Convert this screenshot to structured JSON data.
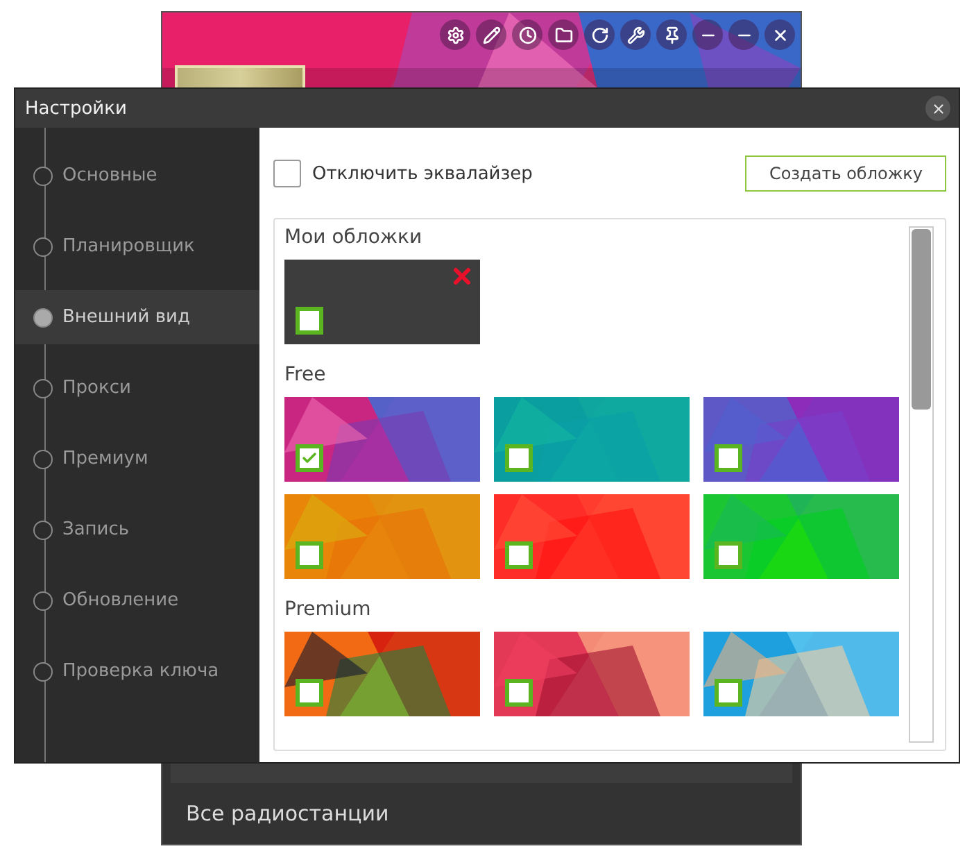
{
  "player": {
    "bottom_label": "Все радиостанции"
  },
  "dialog": {
    "title": "Настройки",
    "sidebar": {
      "items": [
        {
          "label": "Основные",
          "selected": false
        },
        {
          "label": "Планировщик",
          "selected": false
        },
        {
          "label": "Внешний вид",
          "selected": true
        },
        {
          "label": "Прокси",
          "selected": false
        },
        {
          "label": "Премиум",
          "selected": false
        },
        {
          "label": "Запись",
          "selected": false
        },
        {
          "label": "Обновление",
          "selected": false
        },
        {
          "label": "Проверка ключа",
          "selected": false
        }
      ]
    },
    "equalizer_checkbox": {
      "label": "Отключить эквалайзер",
      "checked": false
    },
    "create_button": "Создать обложку",
    "sections": [
      {
        "title": "Мои обложки",
        "skins": [
          {
            "kind": "custom",
            "checked": false,
            "deletable": true
          }
        ]
      },
      {
        "title": "Free",
        "skins": [
          {
            "kind": "picture",
            "checked": true
          },
          {
            "kind": "picture",
            "checked": false
          },
          {
            "kind": "picture",
            "checked": false
          },
          {
            "kind": "picture",
            "checked": false
          },
          {
            "kind": "picture",
            "checked": false
          },
          {
            "kind": "picture",
            "checked": false
          }
        ]
      },
      {
        "title": "Premium",
        "skins": [
          {
            "kind": "picture",
            "checked": false
          },
          {
            "kind": "picture",
            "checked": false
          },
          {
            "kind": "picture",
            "checked": false
          }
        ]
      }
    ]
  }
}
